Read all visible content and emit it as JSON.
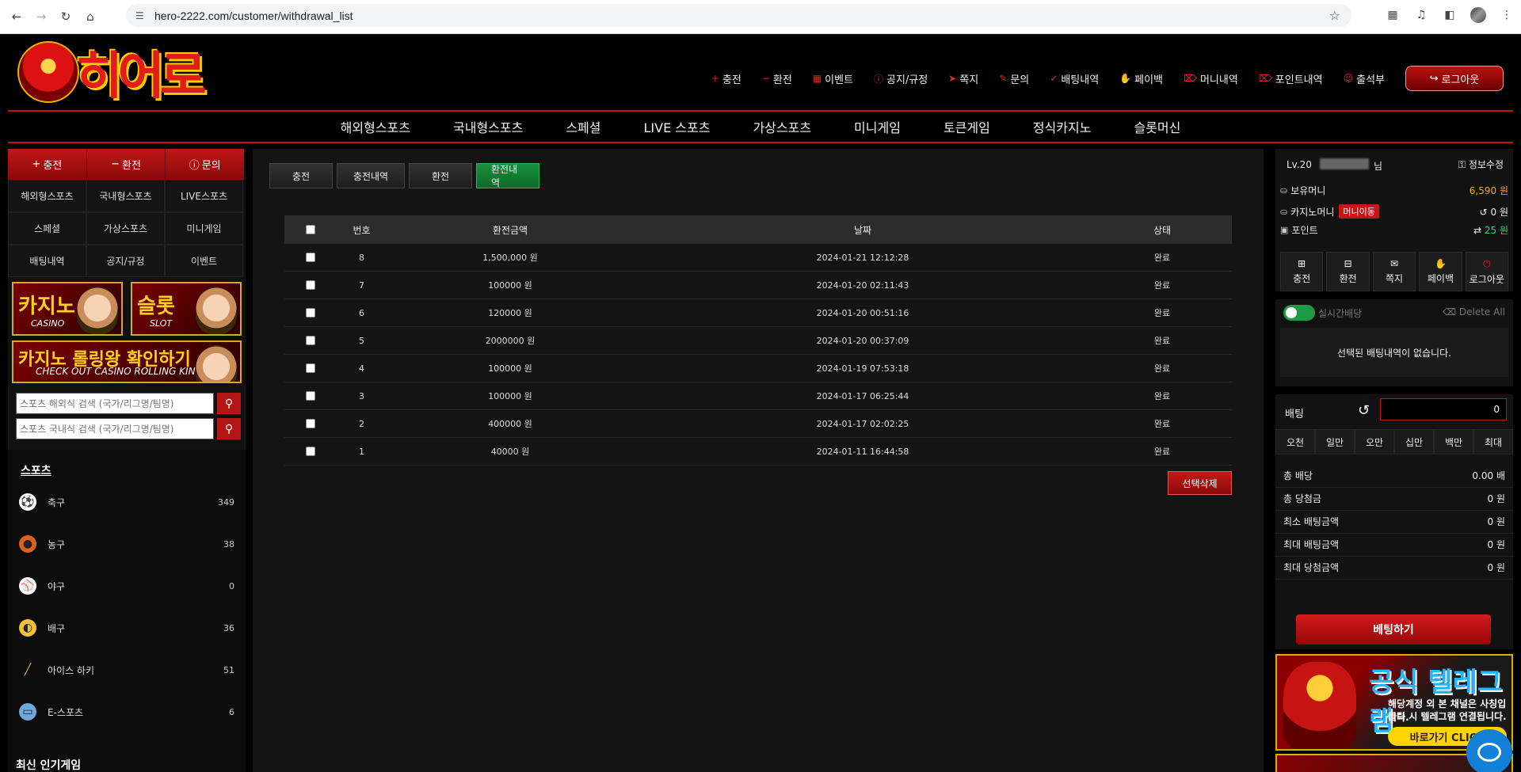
{
  "browser": {
    "url": "hero-2222.com/customer/withdrawal_list"
  },
  "site": {
    "logo_text": "히어로"
  },
  "top_menu": [
    {
      "icon": "plus-icon",
      "label": "충전"
    },
    {
      "icon": "minus-icon",
      "label": "환전"
    },
    {
      "icon": "calendar-icon",
      "label": "이벤트"
    },
    {
      "icon": "exclamation-icon",
      "label": "공지/규정"
    },
    {
      "icon": "paper-plane-icon",
      "label": "쪽지"
    },
    {
      "icon": "edit-icon",
      "label": "문의"
    },
    {
      "icon": "check-icon",
      "label": "배팅내역"
    },
    {
      "icon": "hand-coin-icon",
      "label": "페이백"
    },
    {
      "icon": "trash-icon",
      "label": "머니내역"
    },
    {
      "icon": "trash-icon",
      "label": "포인트내역"
    },
    {
      "icon": "user-icon",
      "label": "출석부"
    }
  ],
  "logout_top": "로그아웃",
  "main_nav": [
    "해외형스포츠",
    "국내형스포츠",
    "스페셜",
    "LIVE 스포츠",
    "가상스포츠",
    "미니게임",
    "토큰게임",
    "정식카지노",
    "슬롯머신"
  ],
  "left": {
    "quick": [
      {
        "icon": "plus-icon",
        "label": "충전"
      },
      {
        "icon": "minus-icon",
        "label": "환전"
      },
      {
        "icon": "exclamation-icon",
        "label": "문의"
      }
    ],
    "grid": [
      "해외형스포츠",
      "국내형스포츠",
      "LIVE스포츠",
      "스페셜",
      "가상스포츠",
      "미니게임",
      "배팅내역",
      "공지/규정",
      "이벤트"
    ],
    "banners": {
      "casino_title": "카지노",
      "casino_sub": "CASINO",
      "slot_title": "슬롯",
      "slot_sub": "SLOT",
      "rolling_title": "카지노 롤링왕 확인하기",
      "rolling_sub": "CHECK OUT CASINO ROLLING KING"
    },
    "search_foreign_placeholder": "스포츠 해외식 검색 (국가/리그명/팀명)",
    "search_domestic_placeholder": "스포츠 국내식 검색 (국가/리그명/팀명)",
    "sports_title": "스포츠",
    "sports": [
      {
        "icon": "soccer-ball-icon",
        "name": "축구",
        "count": "349"
      },
      {
        "icon": "basketball-icon",
        "name": "농구",
        "count": "38"
      },
      {
        "icon": "baseball-icon",
        "name": "야구",
        "count": "0"
      },
      {
        "icon": "volleyball-icon",
        "name": "배구",
        "count": "36"
      },
      {
        "icon": "hockey-stick-icon",
        "name": "아이스 하키",
        "count": "51"
      },
      {
        "icon": "esports-icon",
        "name": "E-스포츠",
        "count": "6"
      }
    ],
    "popular_title": "최신 인기게임"
  },
  "content": {
    "tabs": [
      "충전",
      "충전내역",
      "환전",
      "환전내역"
    ],
    "active_tab": "환전내역",
    "columns": [
      "번호",
      "환전금액",
      "날짜",
      "상태"
    ],
    "rows": [
      {
        "no": "8",
        "amount": "1,500,000 원",
        "date": "2024-01-21 12:12:28",
        "status": "완료"
      },
      {
        "no": "7",
        "amount": "100000 원",
        "date": "2024-01-20 02:11:43",
        "status": "완료"
      },
      {
        "no": "6",
        "amount": "120000 원",
        "date": "2024-01-20 00:51:16",
        "status": "완료"
      },
      {
        "no": "5",
        "amount": "2000000 원",
        "date": "2024-01-20 00:37:09",
        "status": "완료"
      },
      {
        "no": "4",
        "amount": "100000 원",
        "date": "2024-01-19 07:53:18",
        "status": "완료"
      },
      {
        "no": "3",
        "amount": "100000 원",
        "date": "2024-01-17 06:25:44",
        "status": "완료"
      },
      {
        "no": "2",
        "amount": "400000 원",
        "date": "2024-01-17 02:02:25",
        "status": "완료"
      },
      {
        "no": "1",
        "amount": "40000 원",
        "date": "2024-01-11 16:44:58",
        "status": "완료"
      }
    ],
    "delete_button": "선택삭제"
  },
  "right": {
    "level": "Lv.20",
    "nim": "님",
    "edit_info": "정보수정",
    "money_label": "보유머니",
    "money_value": "6,590 원",
    "casino_label": "카지노머니",
    "casino_badge": "머니이동",
    "casino_value": "0 원",
    "point_label": "포인트",
    "point_value": "25 원",
    "actions": [
      {
        "icon": "plus-square-icon",
        "label": "충전"
      },
      {
        "icon": "minus-square-icon",
        "label": "환전"
      },
      {
        "icon": "envelope-icon",
        "label": "쪽지"
      },
      {
        "icon": "hand-coin-icon",
        "label": "페이백"
      },
      {
        "icon": "power-icon",
        "label": "로그아웃"
      }
    ],
    "live_label": "실시간배당",
    "delete_all": "Delete All",
    "empty_msg": "선택된 배팅내역이 없습니다.",
    "bet_label": "배팅",
    "bet_value": "0",
    "amounts": [
      "오천",
      "일만",
      "오만",
      "십만",
      "백만",
      "최대"
    ],
    "summary": [
      {
        "label": "총 배당",
        "value": "0.00 배"
      },
      {
        "label": "총 당첨금",
        "value": "0 원"
      },
      {
        "label": "최소 배팅금액",
        "value": "0 원"
      },
      {
        "label": "최대 배팅금액",
        "value": "0 원"
      },
      {
        "label": "최대 당첨금액",
        "value": "0 원"
      }
    ],
    "bet_button": "베팅하기",
    "tg_title": "공식 텔레그램",
    "tg_line1": "해당계정 외 본 채널은 사칭입니다.",
    "tg_line2": "클릭 시 텔레그램 연결됩니다.",
    "tg_button": "바로가기 CLICK"
  },
  "colors": {
    "accent_red": "#c31313",
    "active_tab_green": "#1a8f3c",
    "money_orange": "#f5a623",
    "point_green": "#3cd15a"
  }
}
